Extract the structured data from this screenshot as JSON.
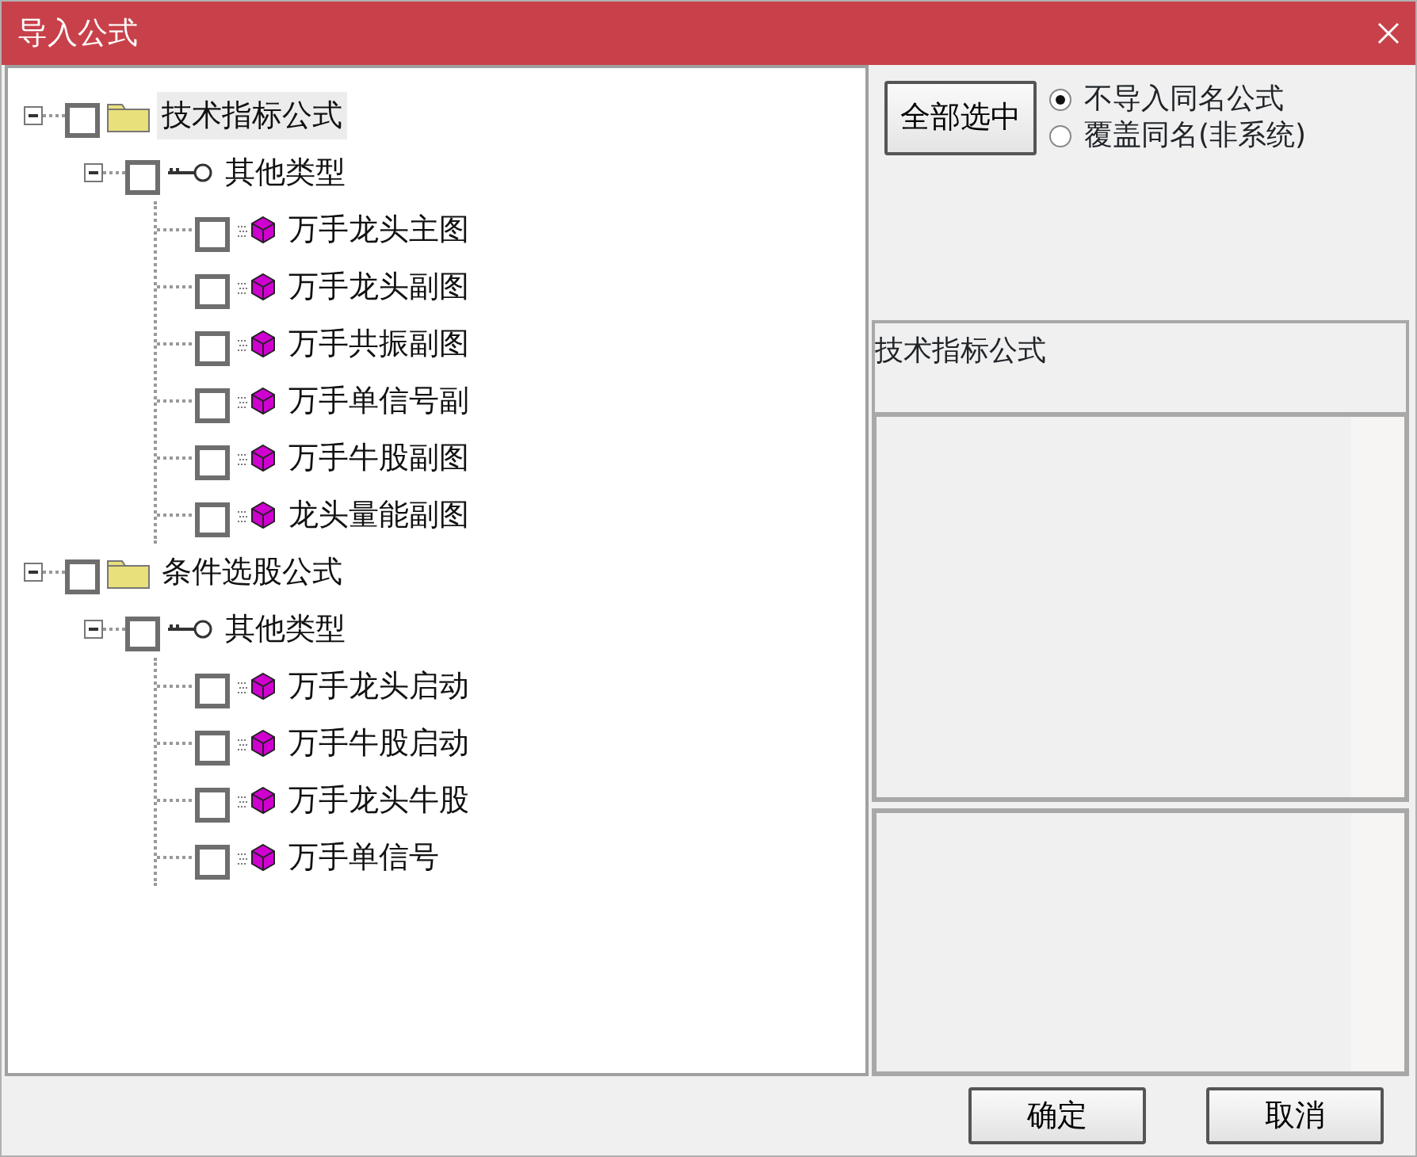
{
  "window": {
    "title": "导入公式"
  },
  "tree": [
    {
      "kind": "category",
      "label": "技术指标公式",
      "expanded": true,
      "checked": false,
      "selected": true,
      "children": [
        {
          "kind": "type",
          "label": "其他类型",
          "expanded": true,
          "checked": false,
          "selected": false,
          "children": [
            {
              "kind": "formula",
              "label": "万手龙头主图",
              "checked": false,
              "selected": false
            },
            {
              "kind": "formula",
              "label": "万手龙头副图",
              "checked": false,
              "selected": false
            },
            {
              "kind": "formula",
              "label": "万手共振副图",
              "checked": false,
              "selected": false
            },
            {
              "kind": "formula",
              "label": "万手单信号副",
              "checked": false,
              "selected": false
            },
            {
              "kind": "formula",
              "label": "万手牛股副图",
              "checked": false,
              "selected": false
            },
            {
              "kind": "formula",
              "label": "龙头量能副图",
              "checked": false,
              "selected": false
            }
          ]
        }
      ]
    },
    {
      "kind": "category",
      "label": "条件选股公式",
      "expanded": true,
      "checked": false,
      "selected": false,
      "children": [
        {
          "kind": "type",
          "label": "其他类型",
          "expanded": true,
          "checked": false,
          "selected": false,
          "children": [
            {
              "kind": "formula",
              "label": "万手龙头启动",
              "checked": false,
              "selected": false
            },
            {
              "kind": "formula",
              "label": "万手牛股启动",
              "checked": false,
              "selected": false
            },
            {
              "kind": "formula",
              "label": "万手龙头牛股",
              "checked": false,
              "selected": false
            },
            {
              "kind": "formula",
              "label": "万手单信号",
              "checked": false,
              "selected": false
            }
          ]
        }
      ]
    }
  ],
  "select_all_button": "全部选中",
  "import_options": [
    {
      "label": "不导入同名公式",
      "selected": true
    },
    {
      "label": "覆盖同名(非系统)",
      "selected": false
    }
  ],
  "description": "技术指标公式",
  "buttons": [
    "确定",
    "取消"
  ]
}
